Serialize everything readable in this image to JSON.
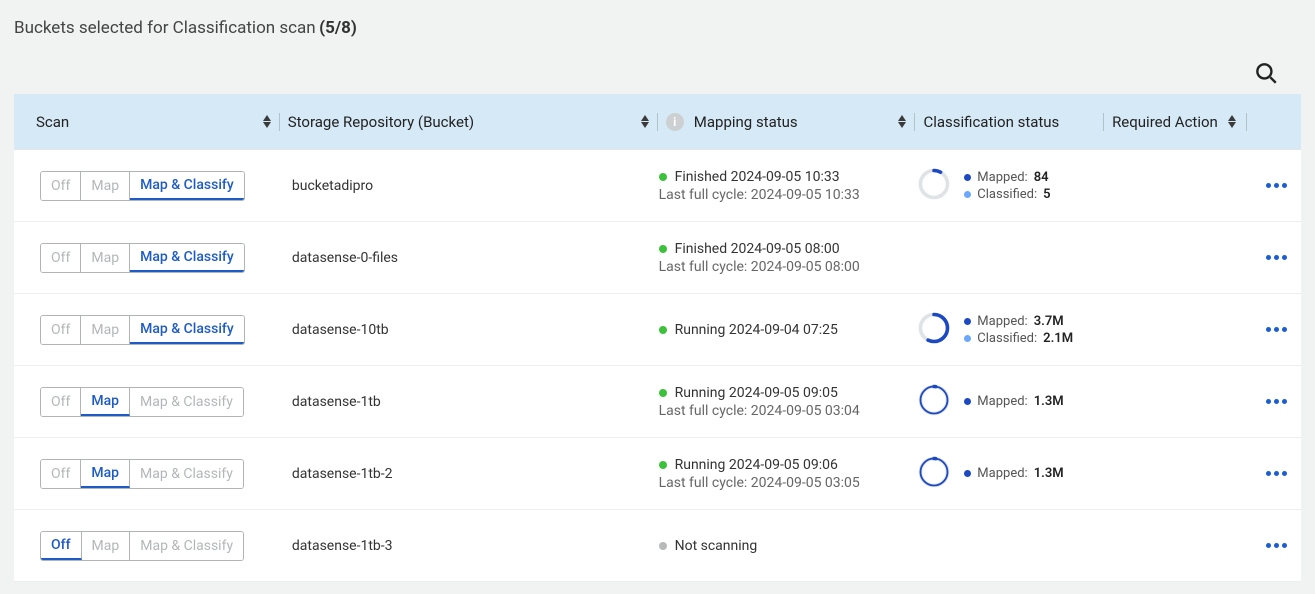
{
  "title": {
    "text": "Buckets selected for Classification scan",
    "count": "(5/8)"
  },
  "columns": {
    "scan": "Scan",
    "repo": "Storage Repository (Bucket)",
    "map": "Mapping status",
    "class": "Classification status",
    "req": "Required Action"
  },
  "scan_labels": {
    "off": "Off",
    "map": "Map",
    "mapclassify": "Map & Classify"
  },
  "status_prefix": {
    "finished": "Finished",
    "running": "Running",
    "notscanning": "Not scanning",
    "lastcycle": "Last full cycle:"
  },
  "class_labels": {
    "mapped": "Mapped:",
    "classified": "Classified:"
  },
  "rows": [
    {
      "scan_active": "mapclassify",
      "repo": "bucketadipro",
      "map_dot": "green",
      "map_status": "Finished",
      "map_time": "2024-09-05 10:33",
      "map_cycle": "2024-09-05 10:33",
      "show_cycle": true,
      "show_class": true,
      "mapped": "84",
      "classified": "5",
      "donut_pct": 8
    },
    {
      "scan_active": "mapclassify",
      "repo": "datasense-0-files",
      "map_dot": "green",
      "map_status": "Finished",
      "map_time": "2024-09-05 08:00",
      "map_cycle": "2024-09-05 08:00",
      "show_cycle": true,
      "show_class": false,
      "mapped": "",
      "classified": "",
      "donut_pct": 0
    },
    {
      "scan_active": "mapclassify",
      "repo": "datasense-10tb",
      "map_dot": "green",
      "map_status": "Running",
      "map_time": "2024-09-04 07:25",
      "show_cycle": false,
      "show_class": true,
      "mapped": "3.7M",
      "classified": "2.1M",
      "donut_pct": 57
    },
    {
      "scan_active": "map",
      "repo": "datasense-1tb",
      "map_dot": "green",
      "map_status": "Running",
      "map_time": "2024-09-05 09:05",
      "map_cycle": "2024-09-05 03:04",
      "show_cycle": true,
      "show_class": true,
      "mapped": "1.3M",
      "classified": "",
      "donut_pct": 2,
      "mapped_only": true
    },
    {
      "scan_active": "map",
      "repo": "datasense-1tb-2",
      "map_dot": "green",
      "map_status": "Running",
      "map_time": "2024-09-05 09:06",
      "map_cycle": "2024-09-05 03:05",
      "show_cycle": true,
      "show_class": true,
      "mapped": "1.3M",
      "classified": "",
      "donut_pct": 2,
      "mapped_only": true
    },
    {
      "scan_active": "off",
      "repo": "datasense-1tb-3",
      "map_dot": "grey",
      "map_status": "Not scanning",
      "map_time": "",
      "show_cycle": false,
      "show_class": false,
      "mapped": "",
      "classified": "",
      "donut_pct": 0
    }
  ]
}
